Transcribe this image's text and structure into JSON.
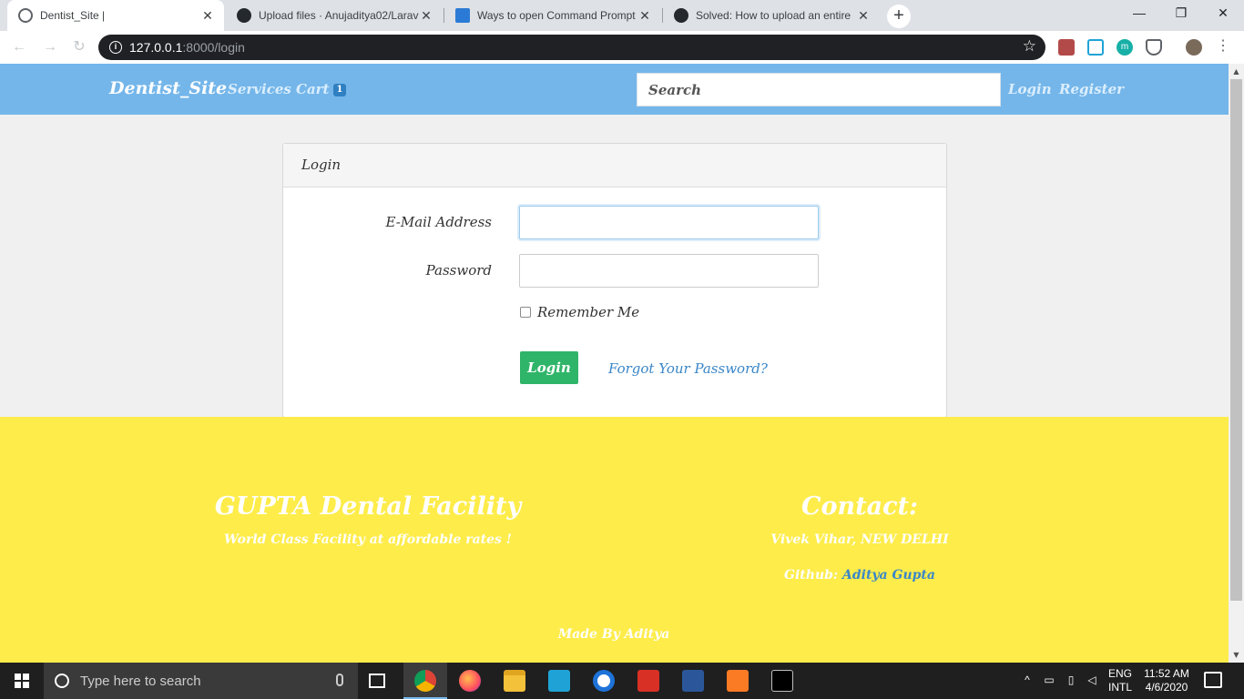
{
  "browser": {
    "tabs": [
      {
        "title": "Dentist_Site |",
        "favicon": "globe-icon",
        "close": "✕"
      },
      {
        "title": "Upload files · Anujaditya02/Larav",
        "favicon": "github-icon",
        "close": "✕"
      },
      {
        "title": "Ways to open Command Prompt",
        "favicon": "windows-icon",
        "close": "✕"
      },
      {
        "title": "Solved: How to upload an entire",
        "favicon": "github-icon",
        "close": "✕"
      }
    ],
    "new_tab": "+",
    "window_controls": {
      "minimize": "—",
      "restore": "❐",
      "close": "✕"
    },
    "nav": {
      "back": "←",
      "forward": "→",
      "reload": "↻"
    },
    "url_host": "127.0.0.1",
    "url_path": ":8000/login",
    "star": "☆"
  },
  "site": {
    "brand": "Dentist_Site",
    "nav": {
      "services": "Services",
      "cart": "Cart",
      "cart_count": "1",
      "login": "Login",
      "register": "Register"
    },
    "search_placeholder": "Search"
  },
  "login_card": {
    "header": "Login",
    "email_label": "E-Mail Address",
    "email_value": "",
    "password_label": "Password",
    "password_value": "",
    "remember_label": "Remember Me",
    "remember_checked": false,
    "login_button": "Login",
    "forgot_link": "Forgot Your Password?"
  },
  "footer": {
    "left_title": "GUPTA Dental Facility",
    "left_tagline": "World Class Facility at affordable rates !",
    "right_title": "Contact:",
    "address": "Vivek Vihar, NEW DELHI",
    "github_label": "Github:",
    "github_link": "Aditya Gupta",
    "made_by": "Made By Aditya"
  },
  "taskbar": {
    "search_placeholder": "Type here to search",
    "language_top": "ENG",
    "language_bottom": "INTL",
    "time": "11:52 AM",
    "date": "4/6/2020"
  },
  "colors": {
    "navbar": "#74b6ea",
    "footer": "#feec4a",
    "login_button": "#2fb569",
    "link": "#3a86c8"
  }
}
